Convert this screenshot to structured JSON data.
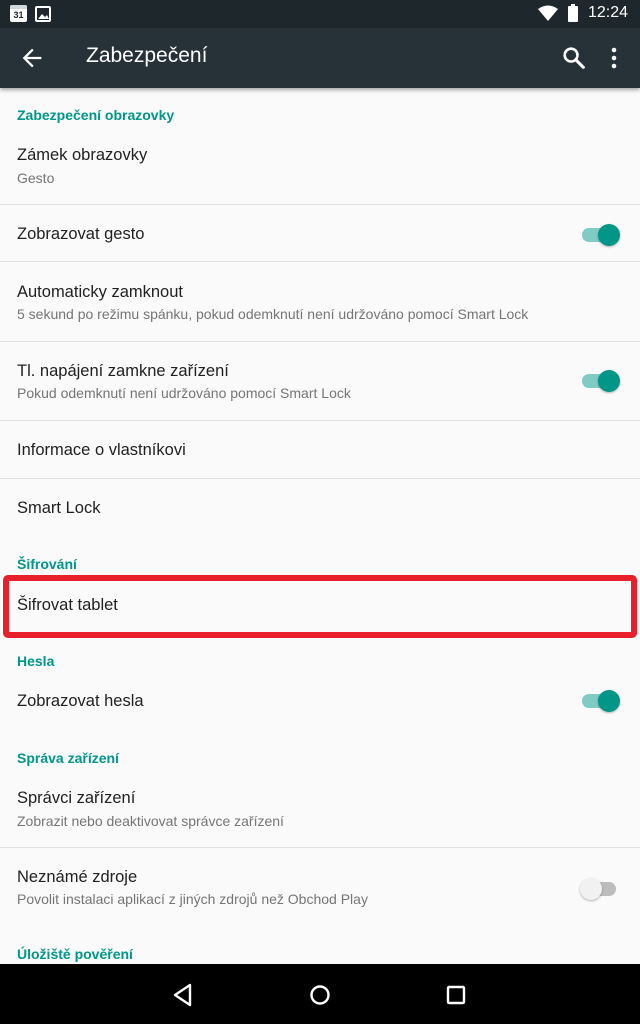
{
  "status_bar": {
    "calendar_day": "31",
    "time": "12:24",
    "icons": [
      "calendar-icon",
      "image-icon",
      "wifi-icon",
      "battery-icon"
    ]
  },
  "app_bar": {
    "title": "Zabezpečení",
    "icons": [
      "back-arrow-icon",
      "search-icon",
      "more-vert-icon"
    ]
  },
  "sections": {
    "screen_security": {
      "header": "Zabezpečení obrazovky",
      "screen_lock": {
        "title": "Zámek obrazovky",
        "subtitle": "Gesto"
      },
      "show_pattern": {
        "title": "Zobrazovat gesto",
        "enabled": true
      },
      "auto_lock": {
        "title": "Automaticky zamknout",
        "subtitle": "5 sekund po režimu spánku, pokud odemknutí není udržováno pomocí Smart Lock"
      },
      "power_button_locks": {
        "title": "Tl. napájení zamkne zařízení",
        "subtitle": "Pokud odemknutí není udržováno pomocí Smart Lock",
        "enabled": true
      },
      "owner_info": {
        "title": "Informace o vlastníkovi"
      },
      "smart_lock": {
        "title": "Smart Lock"
      }
    },
    "encryption": {
      "header": "Šifrování",
      "encrypt_tablet": {
        "title": "Šifrovat tablet",
        "highlighted": true
      }
    },
    "passwords": {
      "header": "Hesla",
      "show_passwords": {
        "title": "Zobrazovat hesla",
        "enabled": true
      }
    },
    "device_admin": {
      "header": "Správa zařízení",
      "device_administrators": {
        "title": "Správci zařízení",
        "subtitle": "Zobrazit nebo deaktivovat správce zařízení"
      },
      "unknown_sources": {
        "title": "Neznámé zdroje",
        "subtitle": "Povolit instalaci aplikací z jiných zdrojů než Obchod Play",
        "enabled": false
      }
    },
    "credential_storage": {
      "header": "Úložiště pověření"
    }
  },
  "nav_bar": {
    "icons": [
      "back-triangle-icon",
      "home-circle-icon",
      "recents-square-icon"
    ]
  },
  "colors": {
    "accent": "#009688",
    "app_bar": "#263238",
    "status_bar": "#1e272b",
    "highlight": "#e8202b"
  }
}
